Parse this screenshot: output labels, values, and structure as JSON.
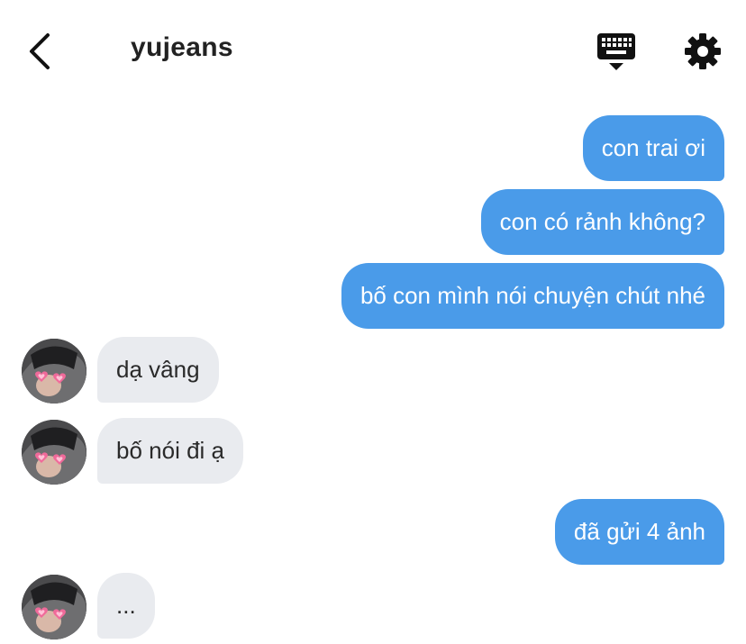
{
  "header": {
    "title": "yujeans",
    "back_icon": "chevron-left-icon",
    "keyboard_icon": "keyboard-icon",
    "settings_icon": "gear-icon"
  },
  "colors": {
    "outgoing_bubble": "#4a9be9",
    "incoming_bubble": "#e9ebef",
    "icon": "#111111"
  },
  "messages": [
    {
      "direction": "out",
      "text": "con trai ơi"
    },
    {
      "direction": "out",
      "text": "con có rảnh không?"
    },
    {
      "direction": "out",
      "text": "bố con mình nói chuyện chút nhé"
    },
    {
      "direction": "in",
      "text": "dạ vâng"
    },
    {
      "direction": "in",
      "text": "bố nói đi ạ"
    },
    {
      "direction": "out",
      "text": "đã gửi 4 ảnh"
    },
    {
      "direction": "in",
      "text": "..."
    }
  ]
}
